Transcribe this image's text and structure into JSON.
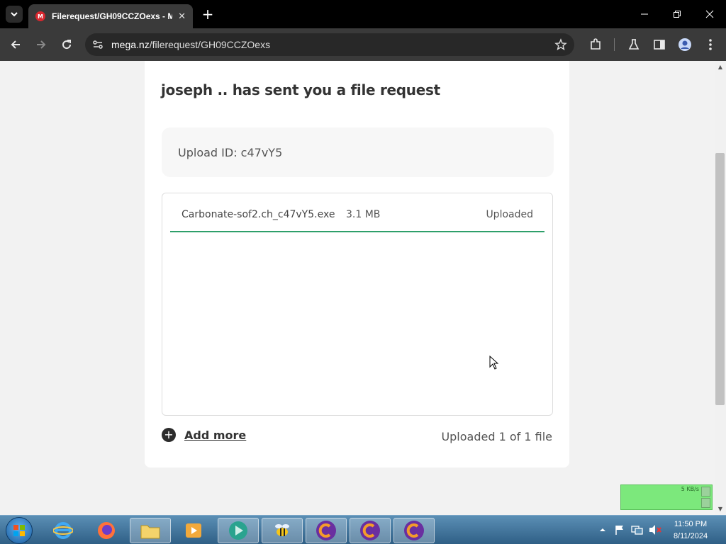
{
  "browser": {
    "tab_title": "Filerequest/GH09CCZOexs - M",
    "favicon_letter": "M",
    "url_host": "mega.nz",
    "url_path": "/filerequest/GH09CCZOexs"
  },
  "page": {
    "heading": "joseph .. has sent you a file request",
    "upload_id": "Upload ID: c47vY5",
    "files": [
      {
        "name": "Carbonate-sof2.ch_c47vY5.exe",
        "size": "3.1 MB",
        "status": "Uploaded",
        "progress_percent": 100
      }
    ],
    "add_more_label": "Add more",
    "upload_count": "Uploaded 1 of 1 file",
    "accent_color": "#2e9f6a"
  },
  "speed_widget": {
    "text": "5 KB/s"
  },
  "taskbar": {
    "apps": [
      "internet-explorer",
      "firefox",
      "file-explorer",
      "media-player",
      "app-teal",
      "app-bee",
      "carbonate-app-1",
      "carbonate-app-2",
      "carbonate-app-3"
    ],
    "time": "11:50 PM",
    "date": "8/11/2024"
  }
}
